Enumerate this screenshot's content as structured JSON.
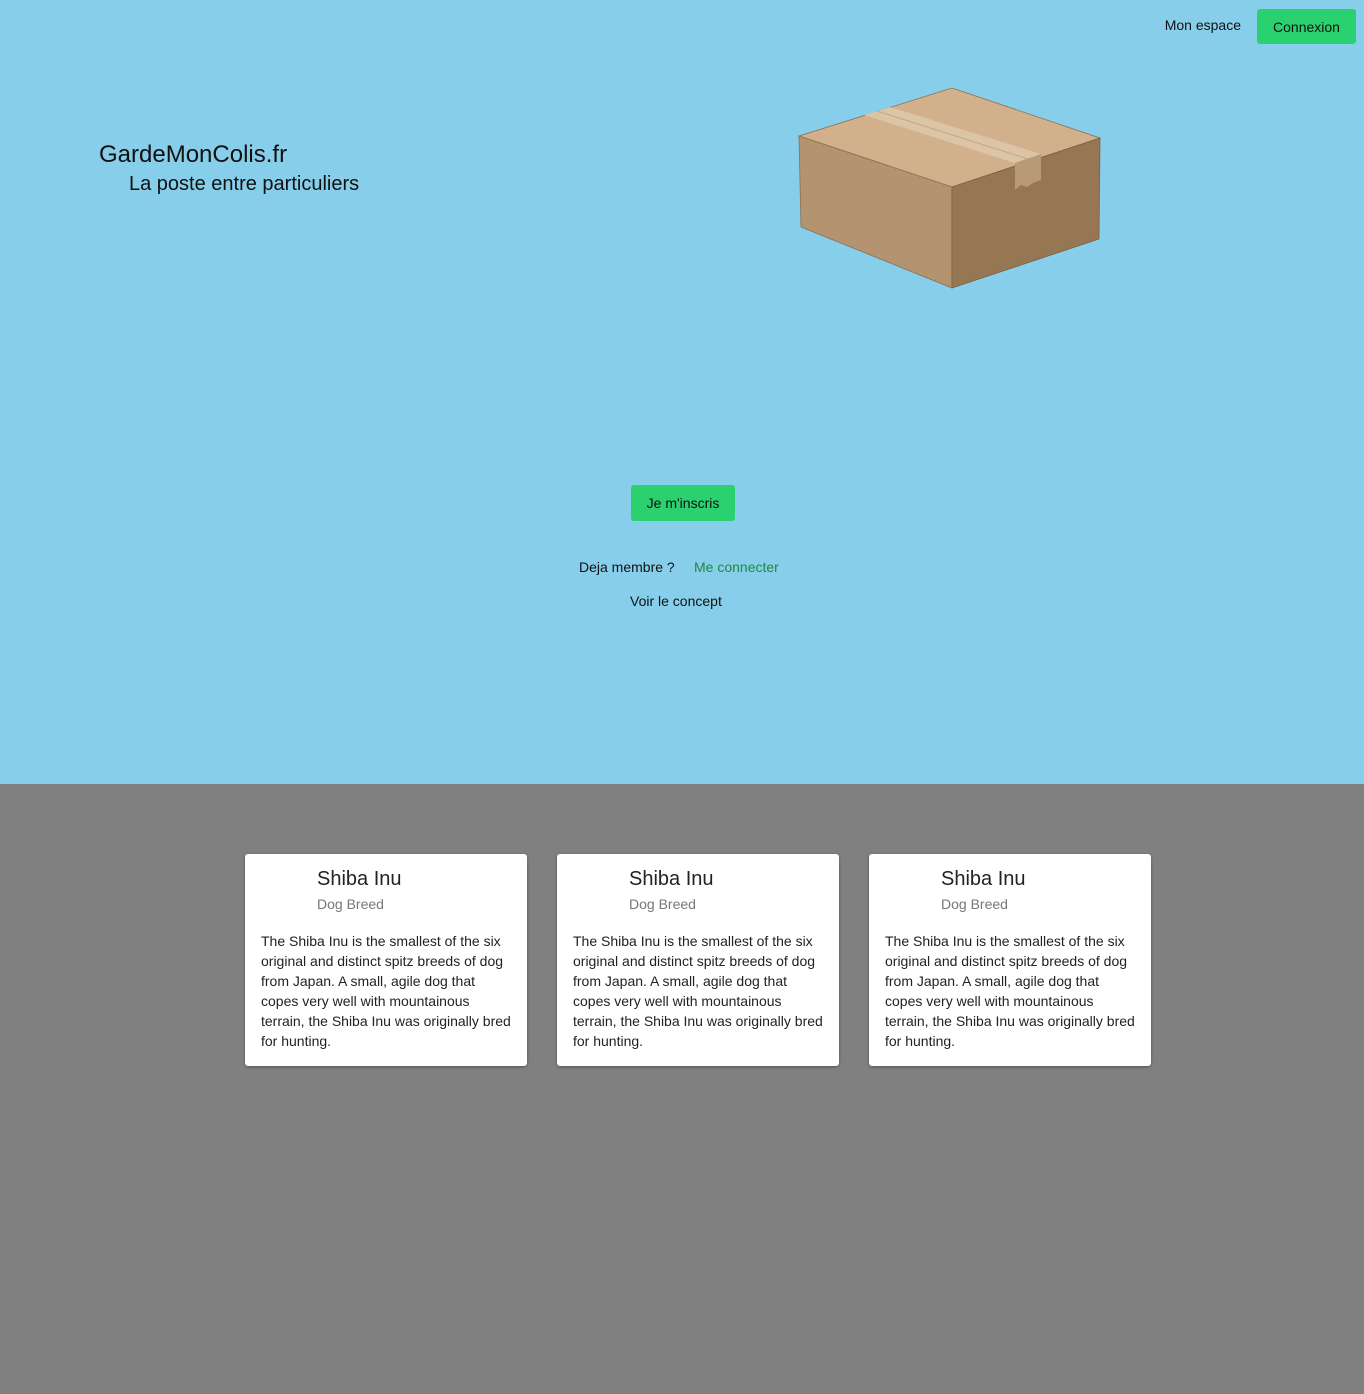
{
  "header": {
    "my_space_label": "Mon espace",
    "login_label": "Connexion"
  },
  "hero": {
    "brand": "GardeMonColis.fr",
    "tagline": "La poste entre particuliers",
    "image": "cardboard-box-illustration",
    "signup_label": "Je m'inscris",
    "member_question": "Deja membre ?",
    "connect_label": "Me connecter",
    "concept_label": "Voir le concept"
  },
  "cards": [
    {
      "title": "Shiba Inu",
      "subtitle": "Dog Breed",
      "text": "The Shiba Inu is the smallest of the six original and distinct spitz breeds of dog from Japan. A small, agile dog that copes very well with mountainous terrain, the Shiba Inu was originally bred for hunting."
    },
    {
      "title": "Shiba Inu",
      "subtitle": "Dog Breed",
      "text": "The Shiba Inu is the smallest of the six original and distinct spitz breeds of dog from Japan. A small, agile dog that copes very well with mountainous terrain, the Shiba Inu was originally bred for hunting."
    },
    {
      "title": "Shiba Inu",
      "subtitle": "Dog Breed",
      "text": "The Shiba Inu is the smallest of the six original and distinct spitz breeds of dog from Japan. A small, agile dog that copes very well with mountainous terrain, the Shiba Inu was originally bred for hunting."
    }
  ],
  "colors": {
    "hero_background": "#87ceeb",
    "lower_background": "#808080",
    "accent_green": "#2bd16f",
    "link_green": "#1e8b3a"
  }
}
